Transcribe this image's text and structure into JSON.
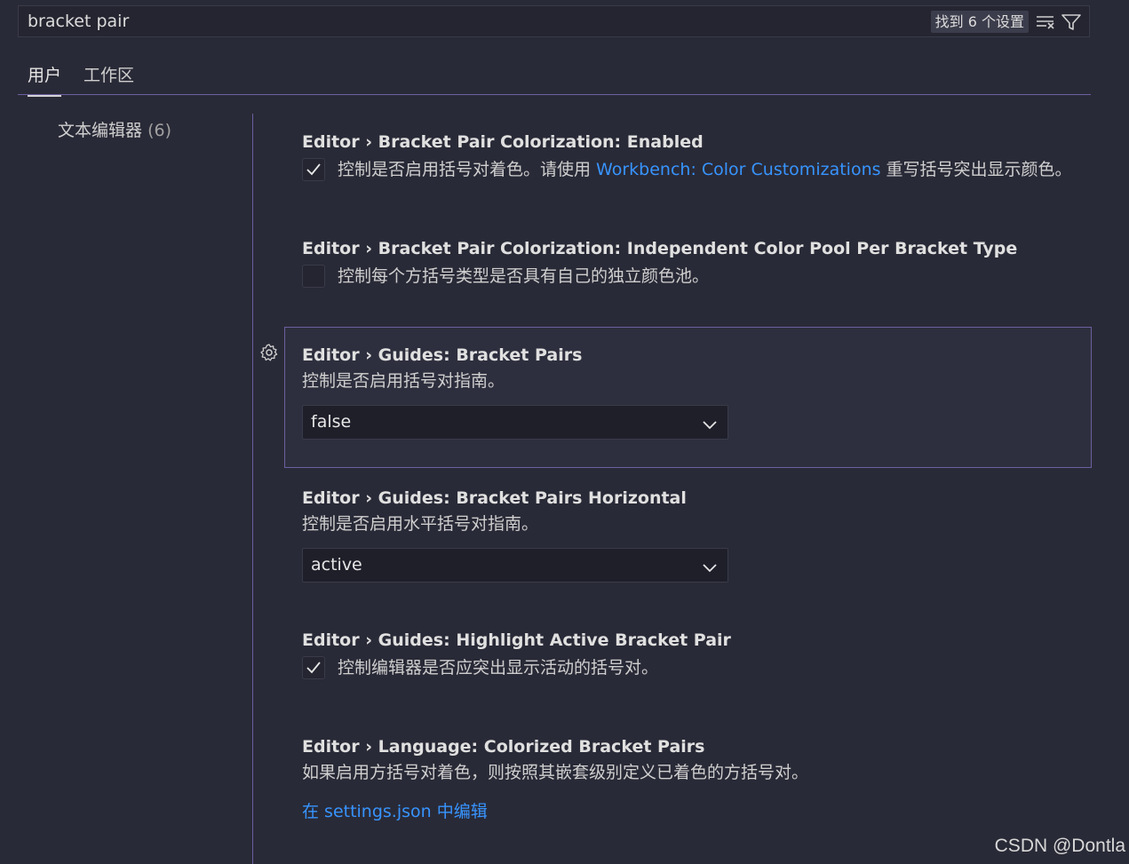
{
  "search": {
    "query": "bracket pair",
    "result_count": "找到 6 个设置",
    "clear_icon": "clear-filter-icon",
    "filter_icon": "filter-icon"
  },
  "tabs": [
    {
      "label": "用户",
      "active": true
    },
    {
      "label": "工作区",
      "active": false
    }
  ],
  "toc": {
    "label": "文本编辑器",
    "count": "(6)"
  },
  "settings": [
    {
      "category": "Editor › ",
      "name": "Bracket Pair Colorization: Enabled",
      "type": "checkbox",
      "checked": true,
      "desc_before": "控制是否启用括号对着色。请使用 ",
      "desc_link": "Workbench: Color Customizations",
      "desc_after": " 重写括号突出显示颜色。"
    },
    {
      "category": "Editor › ",
      "name": "Bracket Pair Colorization: Independent Color Pool Per Bracket Type",
      "type": "checkbox",
      "checked": false,
      "description": "控制每个方括号类型是否具有自己的独立颜色池。"
    },
    {
      "category": "Editor › ",
      "name": "Guides: Bracket Pairs",
      "type": "select",
      "description": "控制是否启用括号对指南。",
      "value": "false",
      "focused": true
    },
    {
      "category": "Editor › ",
      "name": "Guides: Bracket Pairs Horizontal",
      "type": "select",
      "description": "控制是否启用水平括号对指南。",
      "value": "active"
    },
    {
      "category": "Editor › ",
      "name": "Guides: Highlight Active Bracket Pair",
      "type": "checkbox",
      "checked": true,
      "description": "控制编辑器是否应突出显示活动的括号对。"
    },
    {
      "category": "Editor › ",
      "name": "Language: Colorized Bracket Pairs",
      "type": "link",
      "description": "如果启用方括号对着色，则按照其嵌套级别定义已着色的方括号对。",
      "link_label": "在 settings.json 中编辑"
    }
  ],
  "watermark": "CSDN @Dontla",
  "colors": {
    "background": "#292a37",
    "accent_border": "#6b5fa0",
    "link": "#3794ff"
  }
}
